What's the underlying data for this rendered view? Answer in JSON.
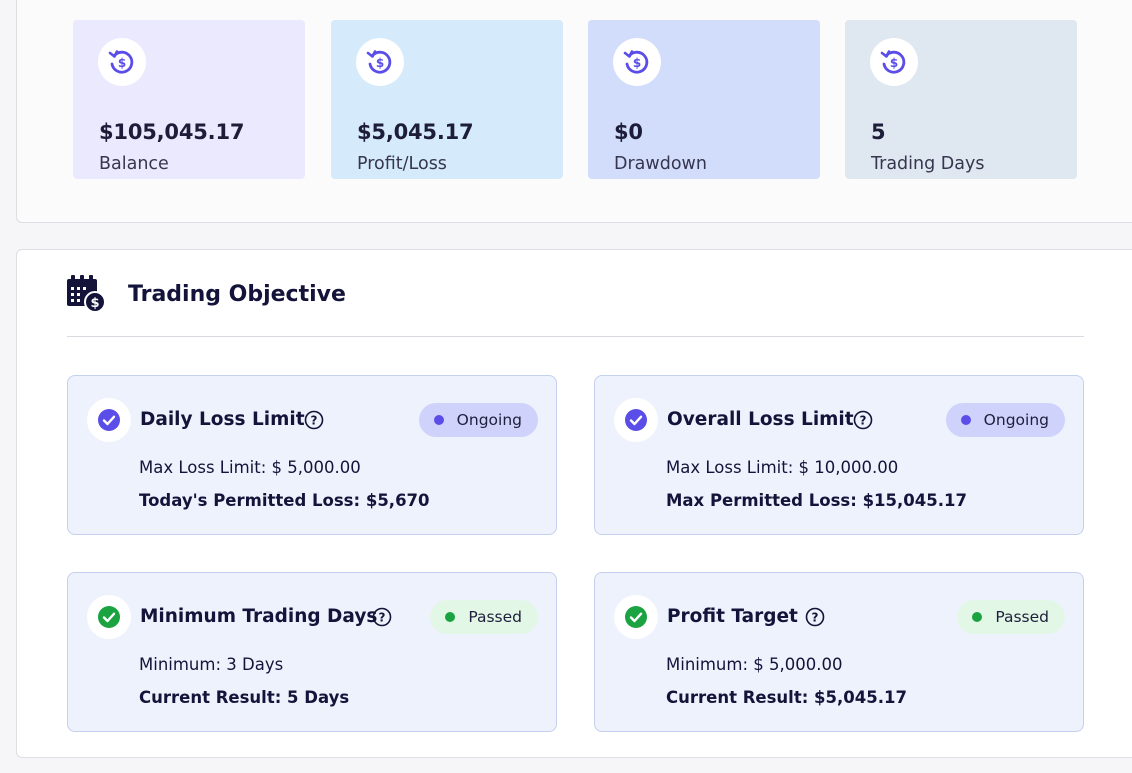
{
  "stats": [
    {
      "value": "$105,045.17",
      "label": "Balance",
      "bg": "#ebe9fd",
      "icon": "dollar-refresh-icon"
    },
    {
      "value": "$5,045.17",
      "label": "Profit/Loss",
      "bg": "#d5ebfb",
      "icon": "dollar-refresh-icon"
    },
    {
      "value": "$0",
      "label": "Drawdown",
      "bg": "#d2ddfb",
      "icon": "dollar-refresh-icon"
    },
    {
      "value": "5",
      "label": "Trading Days",
      "bg": "#dfe8f0",
      "icon": "dollar-refresh-icon"
    }
  ],
  "objective": {
    "title": "Trading Objective",
    "icon": "calendar-dollar-icon",
    "cards": [
      {
        "title": "Daily Loss Limit",
        "status": "Ongoing",
        "line1": "Max Loss Limit: $ 5,000.00",
        "line2": "Today's Permitted Loss: $5,670",
        "status_color": "#5b4ee8"
      },
      {
        "title": "Overall Loss Limit",
        "status": "Ongoing",
        "line1": "Max Loss Limit: $ 10,000.00",
        "line2": "Max Permitted Loss: $15,045.17",
        "status_color": "#5b4ee8"
      },
      {
        "title": "Minimum Trading Days",
        "status": "Passed",
        "line1": "Minimum: 3 Days",
        "line2": "Current Result: 5 Days",
        "status_color": "#1aa340"
      },
      {
        "title": "Profit Target",
        "status": "Passed",
        "line1": "Minimum: $ 5,000.00",
        "line2": "Current Result: $5,045.17",
        "status_color": "#1aa340"
      }
    ]
  }
}
